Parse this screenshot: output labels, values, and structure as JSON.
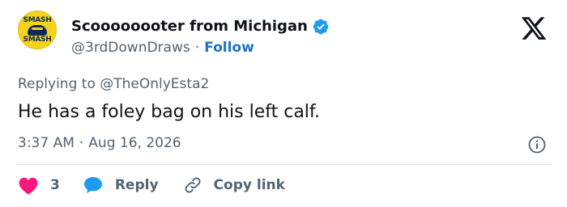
{
  "author": {
    "display_name": "Scoooooooter from Michigan",
    "handle": "@3rdDownDraws",
    "separator": "·",
    "follow_label": "Follow",
    "avatar_text_top": "SMASH",
    "avatar_text_bottom": "SMASH"
  },
  "tweet": {
    "replying_prefix": "Replying to",
    "replying_to": "@TheOnlyEsta2",
    "text": "He has a foley bag on his left calf.",
    "time": "3:37 AM",
    "date_separator": "·",
    "date": "Aug 16, 2026"
  },
  "actions": {
    "like_count": "3",
    "reply_label": "Reply",
    "copy_link_label": "Copy link"
  },
  "colors": {
    "like": "#f91880",
    "reply": "#1d9bf0",
    "verified": "#1d9bf0",
    "follow": "#1d72c4",
    "muted": "#536471"
  },
  "icons": {
    "verified": "verified-badge-icon",
    "logo": "x-logo-icon",
    "info": "info-icon",
    "like": "heart-icon",
    "reply": "speech-bubble-icon",
    "copy": "link-icon"
  }
}
